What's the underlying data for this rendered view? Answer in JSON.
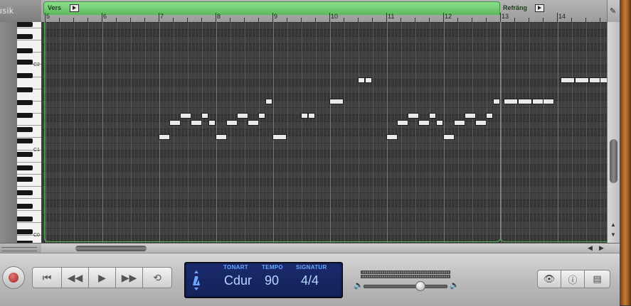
{
  "sidebar": {
    "header_text": "usik"
  },
  "ruler": {
    "regions": [
      {
        "label": "Vers"
      },
      {
        "label": "Refräng"
      }
    ],
    "bars": [
      "5",
      "6",
      "7",
      "8",
      "9",
      "10",
      "11",
      "12",
      "13",
      "14"
    ]
  },
  "piano": {
    "octave_labels": [
      "C2",
      "C1",
      "C0"
    ]
  },
  "transport": {
    "lcd": {
      "key_header": "TONART",
      "key_value": "Cdur",
      "tempo_header": "TEMPO",
      "tempo_value": "90",
      "signature_header": "SIGNATUR",
      "signature_value": "4/4"
    },
    "volume_level": 0.68
  },
  "colors": {
    "region_green": "#5cb85c",
    "lcd_background": "#14225a",
    "lcd_text": "#b9d6ff",
    "grid_background": "#3c3e3c"
  },
  "icons": {
    "record": "record-icon",
    "go_to_start": "skip-start-icon",
    "rewind": "rewind-icon",
    "play": "play-icon",
    "fast_forward": "fast-forward-icon",
    "cycle": "cycle-icon",
    "metronome": "metronome-icon",
    "view": "eye-icon",
    "info": "info-icon",
    "media": "media-browser-icon",
    "pencil": "pencil-icon"
  }
}
